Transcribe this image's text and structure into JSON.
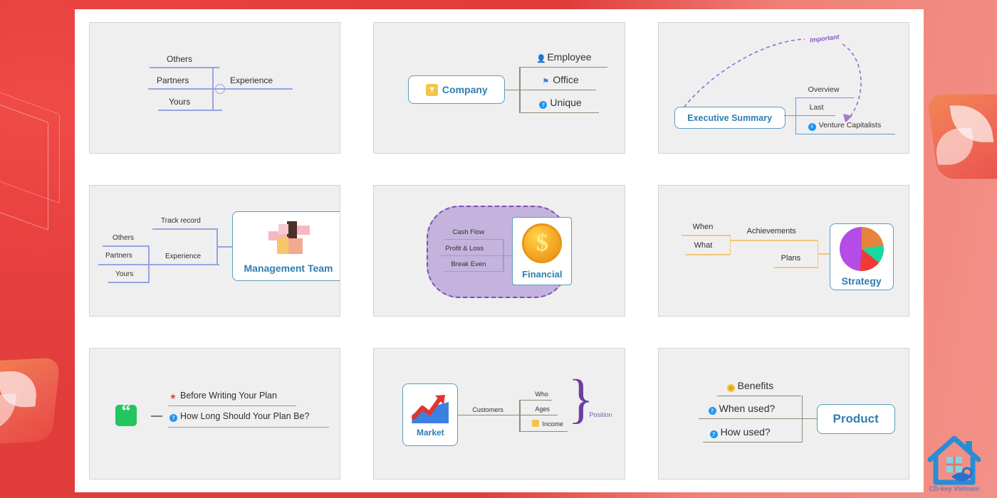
{
  "background": {
    "accent_red": "#e8413f",
    "accent_orange": "#f4884f",
    "watermark_text": "CD-key Vietnam"
  },
  "sheet": {
    "cards": [
      {
        "id": "experience",
        "root_label": "Experience",
        "root_style": "plain-text",
        "branch_color": "#97a4de",
        "children": [
          "Others",
          "Partners",
          "Yours"
        ],
        "collapse_icon": "minus-circle-icon"
      },
      {
        "id": "company",
        "root_label": "Company",
        "root_style": "boxed",
        "root_icon": "yellow-tag-icon",
        "branch_color": "#8d8b78",
        "children": [
          {
            "label": "Employee",
            "icon": "person-icon"
          },
          {
            "label": "Office",
            "icon": "flag-icon"
          },
          {
            "label": "Unique",
            "icon": "question-icon"
          }
        ]
      },
      {
        "id": "executive-summary",
        "root_label": "Executive Summary",
        "root_style": "boxed",
        "branch_color": "#5a9fe0",
        "children": [
          {
            "label": "Overview",
            "icon": ""
          },
          {
            "label": "Last",
            "icon": ""
          },
          {
            "label": "Venture Capitalists",
            "icon": "info-icon"
          }
        ],
        "annotation": {
          "label": "Important",
          "color": "#8b56c4",
          "style": "dashed-arrow"
        }
      },
      {
        "id": "management-team",
        "root_label": "Management Team",
        "root_style": "boxed-image",
        "root_icon": "hands-teamwork-icon",
        "branch_color": "#97a4de",
        "children": [
          "Track record",
          "Experience"
        ],
        "grandchildren": [
          "Others",
          "Partners",
          "Yours"
        ]
      },
      {
        "id": "financial",
        "root_label": "Financial",
        "root_style": "boxed-image",
        "root_icon": "gold-coin-dollar-icon",
        "branch_color": "#8fa0db",
        "children": [
          "Cash Flow",
          "Profit & Loss",
          "Break Even"
        ],
        "boundary": {
          "shape": "cloud",
          "fill": "#c4b3dd",
          "stroke": "#7b4fb0"
        }
      },
      {
        "id": "strategy",
        "root_label": "Strategy",
        "root_style": "boxed-image",
        "root_icon": "pie-chart-icon",
        "branch_color": "#eec87a",
        "children": [
          "Achievements",
          "Plans"
        ],
        "grandchildren": [
          "When",
          "What"
        ]
      },
      {
        "id": "quote",
        "root_label": "",
        "root_style": "icon-only",
        "root_icon": "green-quote-icon",
        "branch_color": "#9d9d9d",
        "children": [
          {
            "label": "Before Writing Your Plan",
            "icon": "red-star-icon"
          },
          {
            "label": "How Long Should Your Plan Be?",
            "icon": "question-icon"
          }
        ]
      },
      {
        "id": "market",
        "root_label": "Market",
        "root_style": "boxed-image",
        "root_icon": "growth-chart-icon",
        "branch_color": "#8d8b78",
        "children": [
          "Customers"
        ],
        "grandchildren": [
          {
            "label": "Who",
            "icon": ""
          },
          {
            "label": "Ages",
            "icon": ""
          },
          {
            "label": "Income",
            "icon": "yellow-note-icon"
          }
        ],
        "boundary": {
          "shape": "brace",
          "label": "Position",
          "color": "#6b3fa0"
        }
      },
      {
        "id": "product",
        "root_label": "Product",
        "root_style": "boxed",
        "branch_color": "#8d8b78",
        "children": [
          {
            "label": "Benefits",
            "icon": "smiley-icon"
          },
          {
            "label": "When used?",
            "icon": "question-icon"
          },
          {
            "label": "How used?",
            "icon": "question-icon"
          }
        ]
      }
    ]
  }
}
